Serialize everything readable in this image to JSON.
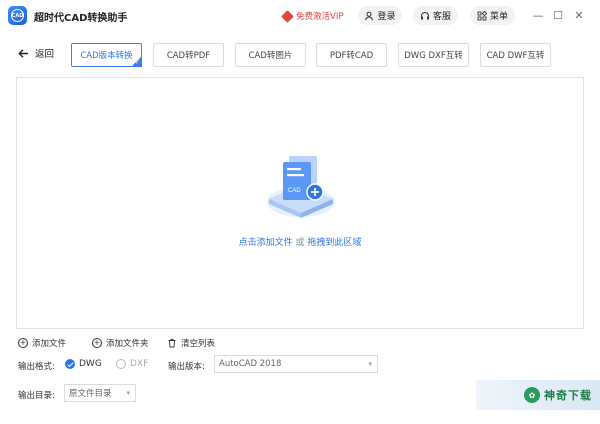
{
  "titlebar": {
    "logo_text": "CAD",
    "title": "超时代CAD转换助手",
    "vip": "免费激活VIP",
    "login": "登录",
    "service": "客服",
    "menu": "菜单",
    "minimize": "—",
    "maximize": "☐",
    "close": "✕"
  },
  "toolbar": {
    "back": "返回",
    "tabs": [
      {
        "label": "CAD版本转换",
        "active": true
      },
      {
        "label": "CAD转PDF",
        "active": false
      },
      {
        "label": "CAD转图片",
        "active": false
      },
      {
        "label": "PDF转CAD",
        "active": false
      },
      {
        "label": "DWG DXF互转",
        "active": false
      },
      {
        "label": "CAD DWF互转",
        "active": false
      }
    ]
  },
  "dropzone": {
    "badge": "CAD",
    "hint_link1": "点击添加文件",
    "hint_or": " 或 ",
    "hint_link2": "拖拽到此区域"
  },
  "actions": {
    "add_file": "添加文件",
    "add_folder": "添加文件夹",
    "clear_list": "清空列表"
  },
  "output": {
    "format_label": "输出格式:",
    "format_options": [
      "DWG",
      "DXF"
    ],
    "format_selected": "DWG",
    "version_label": "输出版本:",
    "version_value": "AutoCAD 2018",
    "dir_label": "输出目录:",
    "dir_value": "原文件目录"
  },
  "watermark": {
    "text": "神奇下载"
  },
  "colors": {
    "accent": "#2d74e8",
    "vip": "#e2463f"
  }
}
